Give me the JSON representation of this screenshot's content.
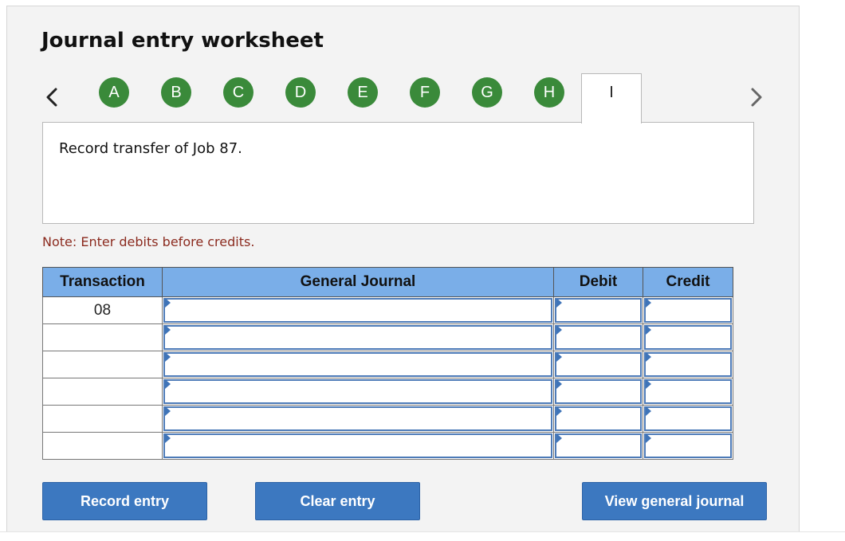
{
  "worksheet": {
    "title": "Journal entry worksheet"
  },
  "steps": {
    "prev_icon": "chevron-left-icon",
    "next_icon": "chevron-right-icon",
    "items": [
      {
        "label": "A"
      },
      {
        "label": "B"
      },
      {
        "label": "C"
      },
      {
        "label": "D"
      },
      {
        "label": "E"
      },
      {
        "label": "F"
      },
      {
        "label": "G"
      },
      {
        "label": "H"
      },
      {
        "label": "I",
        "active": true
      }
    ],
    "completed_color": "#3a8a3a"
  },
  "question": {
    "text": "Record transfer of Job 87."
  },
  "note": {
    "text": "Note: Enter debits before credits."
  },
  "journal": {
    "headers": {
      "transaction": "Transaction",
      "general_journal": "General Journal",
      "debit": "Debit",
      "credit": "Credit"
    },
    "rows": [
      {
        "transaction": "08",
        "account": "",
        "debit": "",
        "credit": ""
      },
      {
        "transaction": "",
        "account": "",
        "debit": "",
        "credit": ""
      },
      {
        "transaction": "",
        "account": "",
        "debit": "",
        "credit": ""
      },
      {
        "transaction": "",
        "account": "",
        "debit": "",
        "credit": ""
      },
      {
        "transaction": "",
        "account": "",
        "debit": "",
        "credit": ""
      },
      {
        "transaction": "",
        "account": "",
        "debit": "",
        "credit": ""
      }
    ],
    "header_color": "#7aaee8"
  },
  "buttons": {
    "record_entry": "Record entry",
    "clear_entry": "Clear entry",
    "view_general_journal": "View general journal",
    "color": "#3c78c0"
  }
}
